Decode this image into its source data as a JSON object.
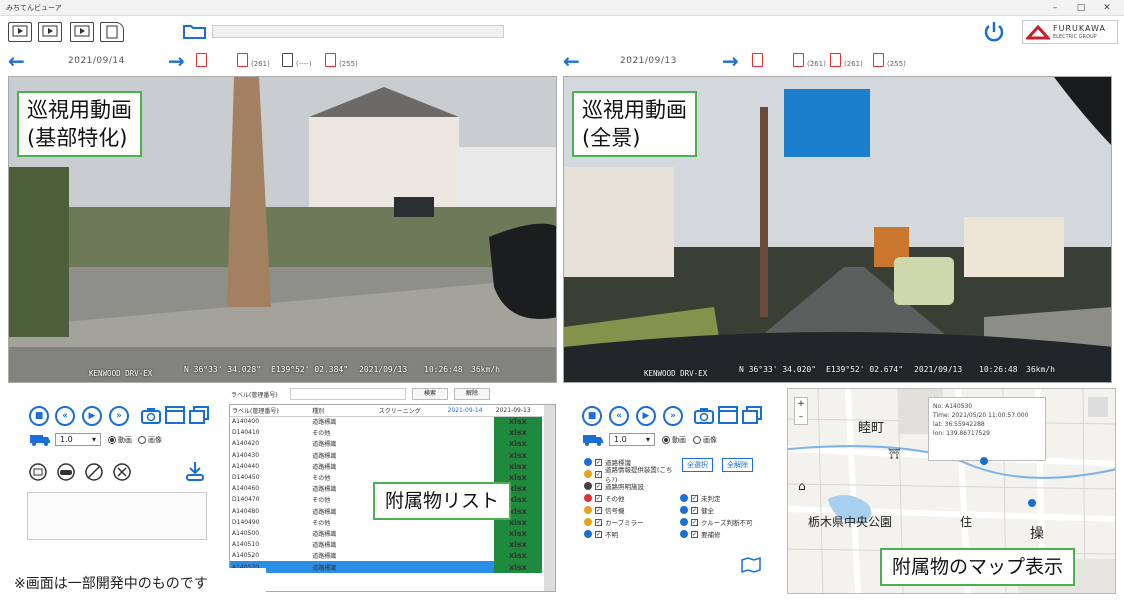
{
  "app": {
    "title": "みちてんビューア"
  },
  "header": {
    "brand_name": "FURUKAWA",
    "brand_sub": "ELECTRIC GROUP"
  },
  "left_panel": {
    "date": "2021/09/14",
    "file_counts": [
      "(261)",
      "(----)",
      "(255)"
    ],
    "video_overlay_line1": "巡視用動画",
    "video_overlay_line2": "(基部特化)",
    "osd": {
      "camera": "KENWOOD DRV-EX",
      "lat": "N 36°33' 34.028\"",
      "lon": "E139°52' 02.384\"",
      "date": "2021/09/13",
      "time": "10:26:48",
      "speed": "36km/h"
    },
    "speed_value": "1.0",
    "mode_options": [
      "動画",
      "画像"
    ]
  },
  "list_panel": {
    "label_title": "ラベル(管理番号)",
    "search_label": "検索",
    "clear_label": "解除",
    "columns": [
      "ラベル(管理番号)",
      "種別",
      "スクリーニング",
      "2021-09-14",
      "2021-09-13"
    ],
    "rows": [
      [
        "A140400",
        "道路標識",
        "",
        "",
        "xlsx"
      ],
      [
        "D140410",
        "その他",
        "",
        "",
        "xlsx"
      ],
      [
        "A140420",
        "道路標識",
        "",
        "",
        "xlsx"
      ],
      [
        "A140430",
        "道路標識",
        "",
        "",
        "xlsx"
      ],
      [
        "A140440",
        "道路標識",
        "",
        "",
        "xlsx"
      ],
      [
        "D140450",
        "その他",
        "",
        "",
        "xlsx"
      ],
      [
        "A140460",
        "道路標識",
        "",
        "",
        "xlsx"
      ],
      [
        "D140470",
        "その他",
        "",
        "",
        "xlsx"
      ],
      [
        "A140480",
        "道路標識",
        "",
        "",
        "xlsx"
      ],
      [
        "D140490",
        "その他",
        "",
        "",
        "xlsx"
      ],
      [
        "A140500",
        "道路標識",
        "",
        "",
        "xlsx"
      ],
      [
        "A140510",
        "道路標識",
        "",
        "",
        "xlsx"
      ],
      [
        "A140520",
        "道路標識",
        "",
        "",
        "xlsx"
      ],
      [
        "A140530",
        "道路標識",
        "",
        "",
        "xlsx"
      ]
    ],
    "overlay_label": "附属物リスト"
  },
  "right_panel": {
    "date": "2021/09/13",
    "file_counts": [
      "(261)",
      "(261)",
      "(255)"
    ],
    "video_overlay_line1": "巡視用動画",
    "video_overlay_line2": "(全景)",
    "osd": {
      "camera": "KENWOOD DRV-EX",
      "lat": "N 36°33' 34.020\"",
      "lon": "E139°52' 02.674\"",
      "date": "2021/09/13",
      "time": "10:26:48",
      "speed": "36km/h"
    },
    "speed_value": "1.0",
    "mode_options": [
      "動画",
      "画像"
    ],
    "select_all_label": "全選択",
    "clear_all_label": "全解除",
    "legend_left": [
      "道路標識",
      "道路情報提供装置(こちら?)",
      "道路照明施設",
      "その他",
      "信号機",
      "カーブミラー",
      "不明"
    ],
    "legend_right": [
      "未判定",
      "健全",
      "クルーズ判断不可",
      "要補修"
    ]
  },
  "map": {
    "labels": [
      "睦町",
      "栃木県中央公園",
      "住",
      "操"
    ],
    "popup": {
      "no": "No: A140530",
      "time": "Time: 2021/05/20 11:00:57.000",
      "lat": "lat: 36.55942288",
      "lon": "lon: 139.86717529"
    },
    "overlay_label": "附属物のマップ表示"
  },
  "footnote": "※画面は一部開発中のものです",
  "colors": {
    "accent": "#1a6fd6",
    "green_label": "#4bb04f",
    "xlsx": "#1e8a3e",
    "selected_row": "#2a8ee6"
  }
}
